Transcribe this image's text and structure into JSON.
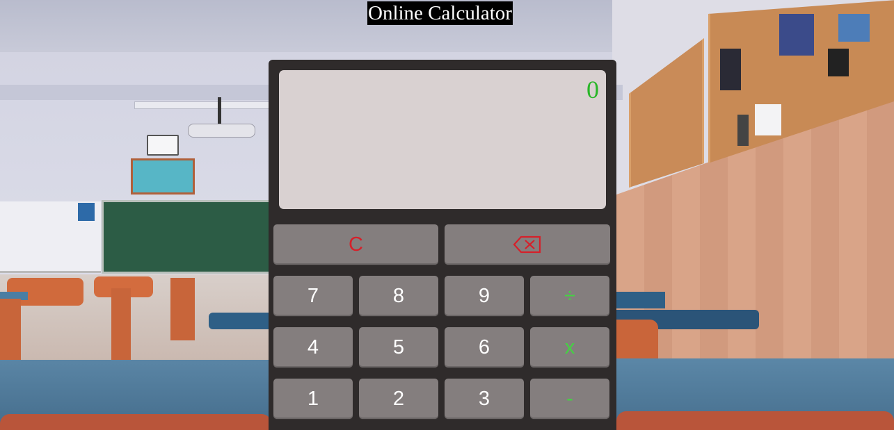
{
  "page": {
    "title": "Online Calculator"
  },
  "calculator": {
    "display_value": "0",
    "keys": {
      "clear": "C",
      "backspace_icon": "backspace-icon",
      "seven": "7",
      "eight": "8",
      "nine": "9",
      "divide": "÷",
      "four": "4",
      "five": "5",
      "six": "6",
      "multiply": "x",
      "one": "1",
      "two": "2",
      "three": "3",
      "subtract": "-"
    }
  },
  "colors": {
    "body_bg": "#2f2b2b",
    "display_bg": "#d9d1d1",
    "display_text": "#29b628",
    "key_bg": "#847e7e",
    "digit_text": "#ffffff",
    "operator_text": "#43d342",
    "control_text": "#d6202a",
    "title_bg": "#000000",
    "title_text": "#ffffff"
  }
}
